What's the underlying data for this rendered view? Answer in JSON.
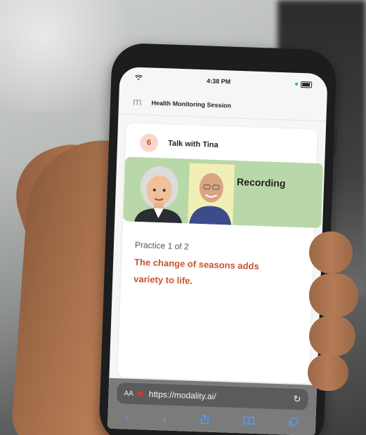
{
  "status_bar": {
    "time": "4:38 PM"
  },
  "app_bar": {
    "logo": "m",
    "title": "Health Monitoring Session"
  },
  "session": {
    "step_number": "6",
    "step_title": "Talk with Tina",
    "recording_label": "Recording",
    "practice_label": "Practice 1 of 2",
    "sentence": "The change of seasons adds variety to life."
  },
  "browser": {
    "aa_label": "AA",
    "url": "https://modality.ai/",
    "back_icon": "chevron-left-icon",
    "forward_icon": "chevron-right-icon",
    "share_icon": "share-icon",
    "bookmarks_icon": "book-icon",
    "tabs_icon": "tabs-icon"
  },
  "colors": {
    "accent_orange": "#c9532c",
    "badge_bg": "#f8d8cc",
    "video_bg": "#b9d8a9",
    "ios_blue": "#4da3ff"
  }
}
